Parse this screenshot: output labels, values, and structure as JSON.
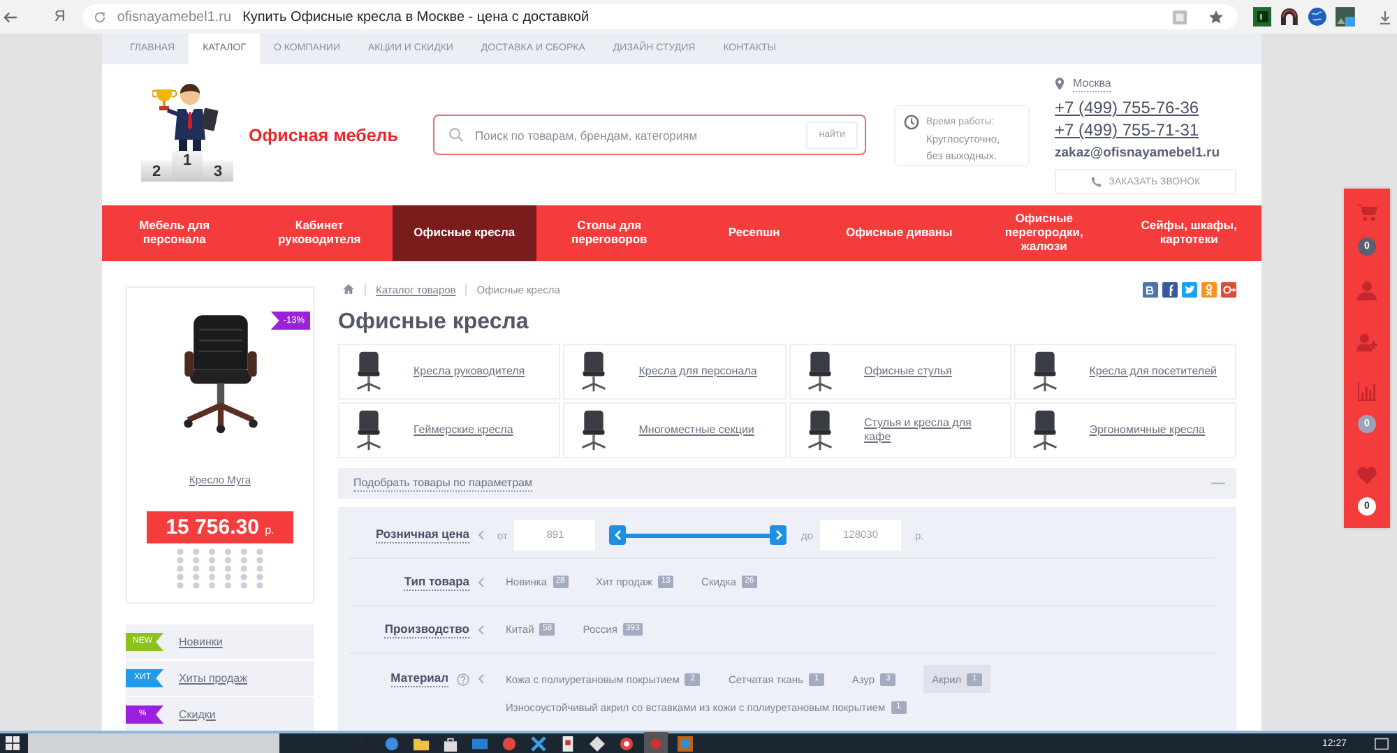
{
  "browser": {
    "home_glyph": "Я",
    "url": "ofisnayamebel1.ru",
    "title": "Купить Офисные кресла в Москве - цена с доставкой"
  },
  "top_nav": [
    {
      "label": "ГЛАВНАЯ",
      "selected": false
    },
    {
      "label": "КАТАЛОГ",
      "selected": true
    },
    {
      "label": "О КОМПАНИИ",
      "selected": false
    },
    {
      "label": "АКЦИИ И СКИДКИ",
      "selected": false
    },
    {
      "label": "ДОСТАВКА И СБОРКА",
      "selected": false
    },
    {
      "label": "ДИЗАЙН СТУДИЯ",
      "selected": false
    },
    {
      "label": "КОНТАКТЫ",
      "selected": false
    }
  ],
  "header": {
    "logo": {
      "podium": [
        "2",
        "1",
        "3"
      ],
      "name": "Офисная мебель"
    },
    "search": {
      "placeholder": "Поиск по товарам, брендам, категориям",
      "button": "найти"
    },
    "hours": {
      "label": "Время работы:",
      "text": "Круглосуточно, без выходных."
    },
    "contacts": {
      "city": "Москва",
      "phones": [
        "+7 (499) 755-76-36",
        "+7 (499) 755-71-31"
      ],
      "email": "zakaz@ofisnayamebel1.ru",
      "callback": "ЗАКАЗАТЬ ЗВОНОК"
    }
  },
  "categories": [
    {
      "label": "Мебель для персонала",
      "selected": false
    },
    {
      "label": "Кабинет руководителя",
      "selected": false
    },
    {
      "label": "Офисные кресла",
      "selected": true
    },
    {
      "label": "Столы для переговоров",
      "selected": false
    },
    {
      "label": "Ресепшн",
      "selected": false
    },
    {
      "label": "Офисные диваны",
      "selected": false
    },
    {
      "label": "Офисные перегородки, жалюзи",
      "selected": false
    },
    {
      "label": "Сейфы, шкафы, картотеки",
      "selected": false
    }
  ],
  "promo_product": {
    "badge": "-13%",
    "name": "Кресло Муга",
    "price": "15 756.30",
    "currency": "р."
  },
  "side_menu": [
    {
      "tag": "NEW",
      "label": "Новинки",
      "color": "#8cc21f"
    },
    {
      "tag": "ХИТ",
      "label": "Хиты продаж",
      "color": "#1f9bea"
    },
    {
      "tag": "%",
      "label": "Скидки",
      "color": "#9a1fe0"
    }
  ],
  "breadcrumb": [
    "Каталог товаров",
    "Офисные кресла"
  ],
  "page_title": "Офисные кресла",
  "subcategories": [
    "Кресла руководителя",
    "Кресла для персонала",
    "Офисные стулья",
    "Кресла для посетителей",
    "Геймерские кресла",
    "Многоместные секции",
    "Стулья и кресла для кафе",
    "Эргономичные кресла"
  ],
  "filter": {
    "title": "Подобрать товары по параметрам",
    "price": {
      "label": "Розничная цена",
      "from_label": "от",
      "from": "891",
      "to_label": "до",
      "to": "128030",
      "currency": "р.",
      "level": 1
    },
    "groups": [
      {
        "label": "Тип товара",
        "help": false,
        "options": [
          {
            "label": "Новинка",
            "count": "28",
            "selected": false
          },
          {
            "label": "Хит продаж",
            "count": "13",
            "selected": false
          },
          {
            "label": "Скидка",
            "count": "26",
            "selected": false
          }
        ]
      },
      {
        "label": "Производство",
        "help": false,
        "options": [
          {
            "label": "Китай",
            "count": "58",
            "selected": false
          },
          {
            "label": "Россия",
            "count": "393",
            "selected": false
          }
        ]
      },
      {
        "label": "Материал",
        "help": true,
        "options": [
          {
            "label": "Кожа с полиуретановым покрытием",
            "count": "2",
            "selected": false
          },
          {
            "label": "Сетчатая ткань",
            "count": "1",
            "selected": false
          },
          {
            "label": "Азур",
            "count": "3",
            "selected": false
          },
          {
            "label": "Акрил",
            "count": "1",
            "selected": true
          },
          {
            "label": "Износоустойчивый акрил со вставками из кожи с полиуретановым покрытием",
            "count": "1",
            "selected": false
          }
        ]
      }
    ]
  },
  "quick_panel": {
    "cart_count": "0",
    "compare_count": "0",
    "favorites_count": "0"
  },
  "taskbar": {
    "time": "12:27"
  }
}
